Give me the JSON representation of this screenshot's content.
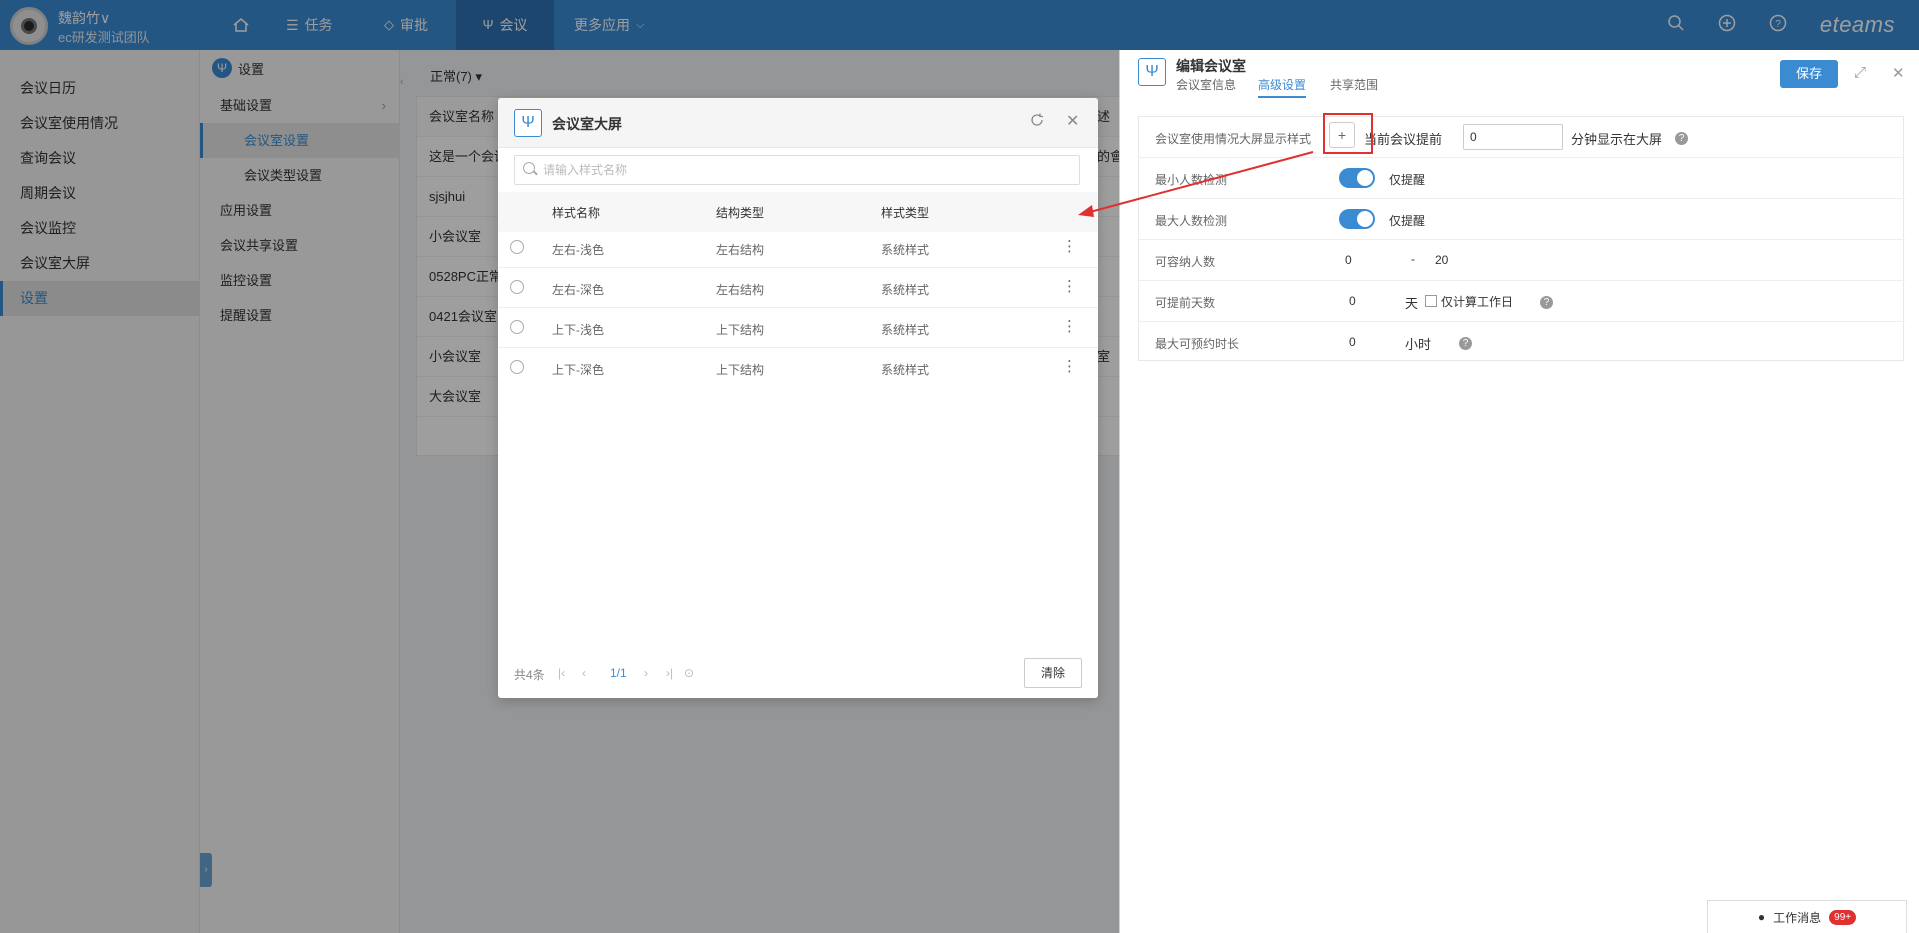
{
  "header": {
    "user_name": "魏韵竹∨",
    "team_name": "ec研发测试团队",
    "nav": [
      {
        "label": "任务"
      },
      {
        "label": "审批"
      },
      {
        "label": "会议"
      },
      {
        "label": "更多应用"
      }
    ],
    "brand": "eteams"
  },
  "sidebar": {
    "items": [
      {
        "label": "会议日历"
      },
      {
        "label": "会议室使用情况"
      },
      {
        "label": "查询会议"
      },
      {
        "label": "周期会议"
      },
      {
        "label": "会议监控"
      },
      {
        "label": "会议室大屏"
      },
      {
        "label": "设置"
      }
    ]
  },
  "subnav": {
    "title": "设置",
    "items": [
      {
        "label": "基础设置"
      },
      {
        "label": "会议室设置"
      },
      {
        "label": "会议类型设置"
      },
      {
        "label": "应用设置"
      },
      {
        "label": "会议共享设置"
      },
      {
        "label": "监控设置"
      },
      {
        "label": "提醒设置"
      }
    ]
  },
  "list": {
    "filter": "正常(7) ▾",
    "header": "会议室名称",
    "header_right": "述",
    "rows": [
      {
        "name": "这是一个会议",
        "right": "的會"
      },
      {
        "name": "sjsjhui",
        "right": ""
      },
      {
        "name": "小会议室",
        "right": ""
      },
      {
        "name": "0528PC正常",
        "right": ""
      },
      {
        "name": "0421会议室",
        "right": ""
      },
      {
        "name": "小会议室",
        "right": "室"
      },
      {
        "name": "大会议室",
        "right": ""
      }
    ]
  },
  "drawer": {
    "title": "编辑会议室",
    "tabs": [
      {
        "label": "会议室信息"
      },
      {
        "label": "高级设置"
      },
      {
        "label": "共享范围"
      }
    ],
    "save_label": "保存",
    "settings": {
      "screen_style_label": "会议室使用情况大屏显示样式",
      "before_meeting_label": "当前会议提前",
      "before_minutes_value": "0",
      "minutes_suffix": "分钟显示在大屏",
      "min_people_label": "最小人数检测",
      "min_people_option": "仅提醒",
      "max_people_label": "最大人数检测",
      "max_people_option": "仅提醒",
      "capacity_label": "可容纳人数",
      "capacity_min": "0",
      "capacity_sep": "-",
      "capacity_max": "20",
      "advance_days_label": "可提前天数",
      "advance_days_value": "0",
      "days_unit": "天",
      "workday_only_label": "仅计算工作日",
      "max_duration_label": "最大可预约时长",
      "max_duration_value": "0",
      "hours_unit": "小时"
    }
  },
  "modal": {
    "title": "会议室大屏",
    "search_placeholder": "请输入样式名称",
    "columns": [
      "样式名称",
      "结构类型",
      "样式类型"
    ],
    "rows": [
      {
        "name": "左右-浅色",
        "structure": "左右结构",
        "type": "系统样式"
      },
      {
        "name": "左右-深色",
        "structure": "左右结构",
        "type": "系统样式"
      },
      {
        "name": "上下-浅色",
        "structure": "上下结构",
        "type": "系统样式"
      },
      {
        "name": "上下-深色",
        "structure": "上下结构",
        "type": "系统样式"
      }
    ],
    "total": "共4条",
    "page": "1/1",
    "clear_label": "清除"
  },
  "work_message": {
    "label": "工作消息",
    "count": "99+"
  },
  "colors": {
    "primary": "#3b8bd3",
    "annotation": "#e03030"
  }
}
